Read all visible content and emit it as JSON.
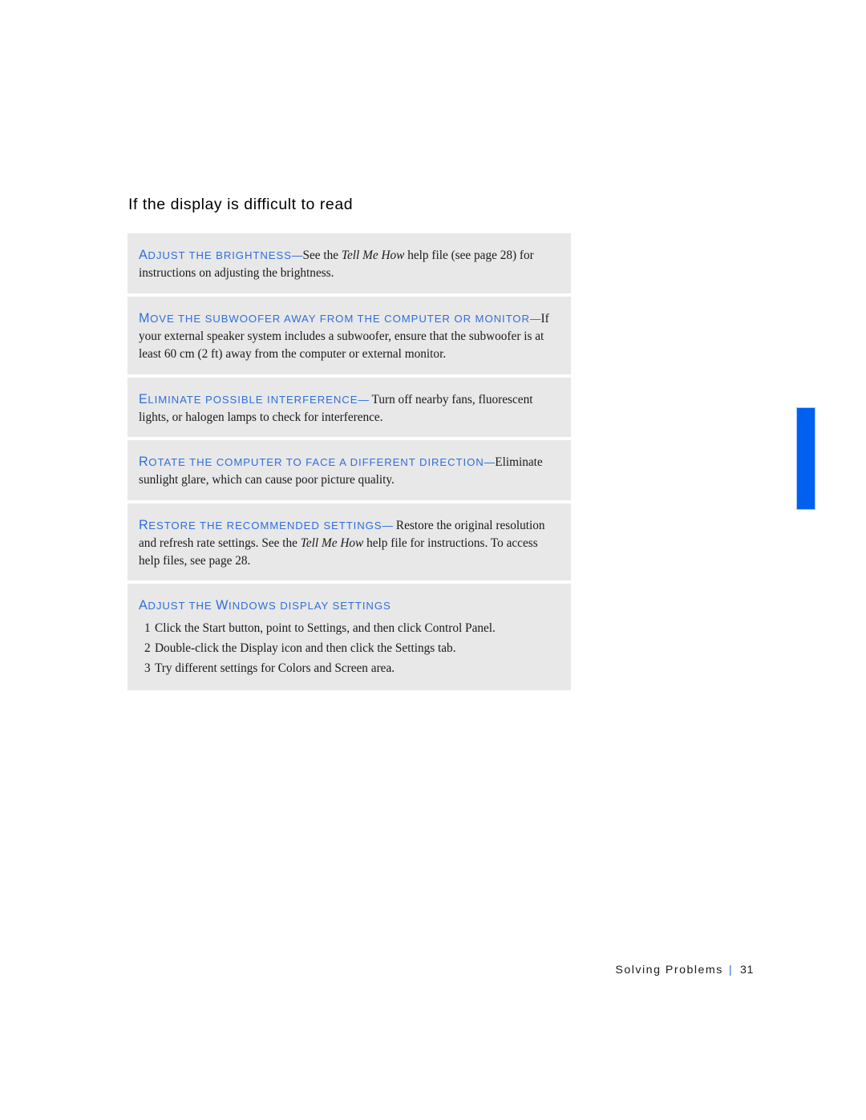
{
  "page": {
    "heading": "If the display is difficult to read",
    "footer": {
      "section": "Solving Problems",
      "separator": "|",
      "page_number": "31"
    },
    "accent_color": "#2f6fdb",
    "edge_tab_color": "#0060f0",
    "box_background": "#e8e8e8"
  },
  "tips": [
    {
      "term_first_letter": "A",
      "term_rest": "DJUST THE BRIGHTNESS",
      "dash": "—",
      "body_before_italic": "See the ",
      "italic": "Tell Me How",
      "body_after_italic": " help file (see page 28) for instructions on adjusting the brightness."
    },
    {
      "term_first_letter": "M",
      "term_rest": "OVE THE SUBWOOFER AWAY FROM THE COMPUTER OR MONITOR",
      "dash": "—",
      "body_before_italic": "If your external speaker system includes a subwoofer, ensure that the subwoofer is at least 60 cm (2 ft) away from the computer or external monitor.",
      "italic": "",
      "body_after_italic": ""
    },
    {
      "term_first_letter": "E",
      "term_rest": "LIMINATE POSSIBLE INTERFERENCE",
      "dash": "—",
      "body_before_italic": " Turn off nearby fans, fluorescent lights, or halogen lamps to check for interference.",
      "italic": "",
      "body_after_italic": ""
    },
    {
      "term_first_letter": "R",
      "term_rest": "OTATE THE COMPUTER TO FACE A DIFFERENT DIRECTION",
      "dash": "—",
      "body_before_italic": "Eliminate sunlight glare, which can cause poor picture quality.",
      "italic": "",
      "body_after_italic": ""
    },
    {
      "term_first_letter": "R",
      "term_rest": "ESTORE THE RECOMMENDED SETTINGS",
      "dash": "—",
      "body_before_italic": " Restore the original resolution and refresh rate settings. See the ",
      "italic": "Tell Me How",
      "body_after_italic": " help file for instructions. To access help files, see page 28."
    }
  ],
  "procedure": {
    "term_first_letter": "A",
    "term_rest_1": "DJUST THE ",
    "term_cap_2": "W",
    "term_rest_2": "INDOWS DISPLAY SETTINGS",
    "steps": [
      {
        "num": "1",
        "text": "Click the Start button, point to Settings, and then click Control Panel."
      },
      {
        "num": "2",
        "text": "Double-click the Display icon and then click the Settings tab."
      },
      {
        "num": "3",
        "text": "Try different settings for Colors and Screen area."
      }
    ]
  }
}
